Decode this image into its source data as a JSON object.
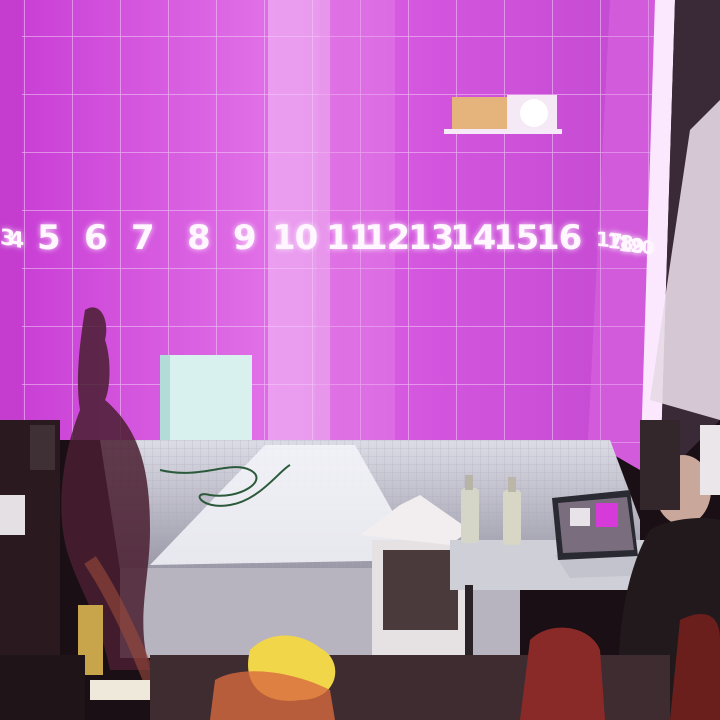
{
  "scene": {
    "description_visible": "",
    "numbers": {
      "left_wall": [
        "3",
        "4"
      ],
      "back_wall": [
        "5",
        "6",
        "7",
        "8",
        "9",
        "10",
        "11",
        "12",
        "13",
        "14",
        "15",
        "16"
      ],
      "right_wall": [
        "17",
        "18",
        "19",
        "20"
      ]
    },
    "colors": {
      "projection_magenta": "#d94fe0",
      "projection_light": "#f2b4f5",
      "floor_white": "#e8e8f0",
      "dark": "#1a0f14"
    }
  }
}
